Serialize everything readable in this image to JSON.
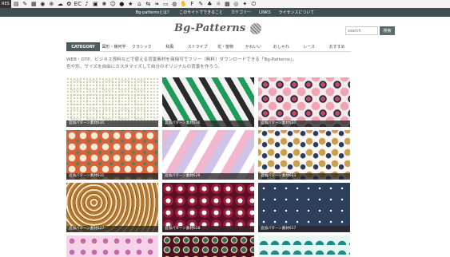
{
  "iconbar": {
    "pres_label": "RES",
    "icons": [
      "trash-icon",
      "tag-icon",
      "grid-icon",
      "camera-icon",
      "font-icon",
      "cloud-icon",
      "leaf-icon",
      "ec-icon",
      "music-icon",
      "bag-icon",
      "flower-icon",
      "smile-icon",
      "circle-icon",
      "star-icon",
      "chair-icon",
      "car-icon",
      "leaf2-icon",
      "road-icon",
      "ball-icon",
      "hand-icon",
      "f-icon",
      "chat-icon",
      "plant-icon",
      "sun-icon",
      "pattern-icon",
      "spiral-icon",
      "note-icon",
      "power-icon"
    ],
    "glyphs": [
      "▤",
      "✎",
      "▦",
      "◉",
      "⊕",
      "☁",
      "✿",
      "EC",
      "♪",
      "▣",
      "❀",
      "☺",
      "●",
      "★",
      "⌂",
      "⇆",
      "❧",
      "▭",
      "◍",
      "✋",
      "F",
      "✎",
      "♣",
      "☼",
      "▩",
      "◎",
      "✦",
      "⏻"
    ]
  },
  "topstrip": {
    "links": [
      "Bg-patternsとは？",
      "このサイトでできること",
      "カテゴリー",
      "LINKS",
      "ライセンスについて"
    ]
  },
  "header": {
    "logo": "Bg-Patterns",
    "search_placeholder": "search",
    "search_button": "検索"
  },
  "nav": {
    "category": "CATEGORY",
    "items": [
      "図形・幾何学",
      "クラシック",
      "和風",
      "ストライプ",
      "花・植物",
      "かわいい",
      "おしゃれ",
      "レース",
      "おすすめ"
    ]
  },
  "intro": {
    "line1": "WEB・DTP、ビジネス資料などで使える背景素材を商用可でフリー（無料）ダウンロードできる「Bg-Patterns」。",
    "line2": "色や形、サイズを自由にカスタマイズして自分のオリジナルの背景を作ろう。"
  },
  "tiles": [
    {
      "caption": "追加パターン素材635"
    },
    {
      "caption": "追加パターン素材636"
    },
    {
      "caption": "追加パターン素材637"
    },
    {
      "caption": "追加パターン素材631"
    },
    {
      "caption": "追加パターン素材629"
    },
    {
      "caption": "追加パターン素材623"
    },
    {
      "caption": "追加パターン素材627"
    },
    {
      "caption": "追加パターン素材618"
    },
    {
      "caption": "追加パターン素材617"
    },
    {
      "caption": ""
    },
    {
      "caption": ""
    },
    {
      "caption": ""
    }
  ]
}
